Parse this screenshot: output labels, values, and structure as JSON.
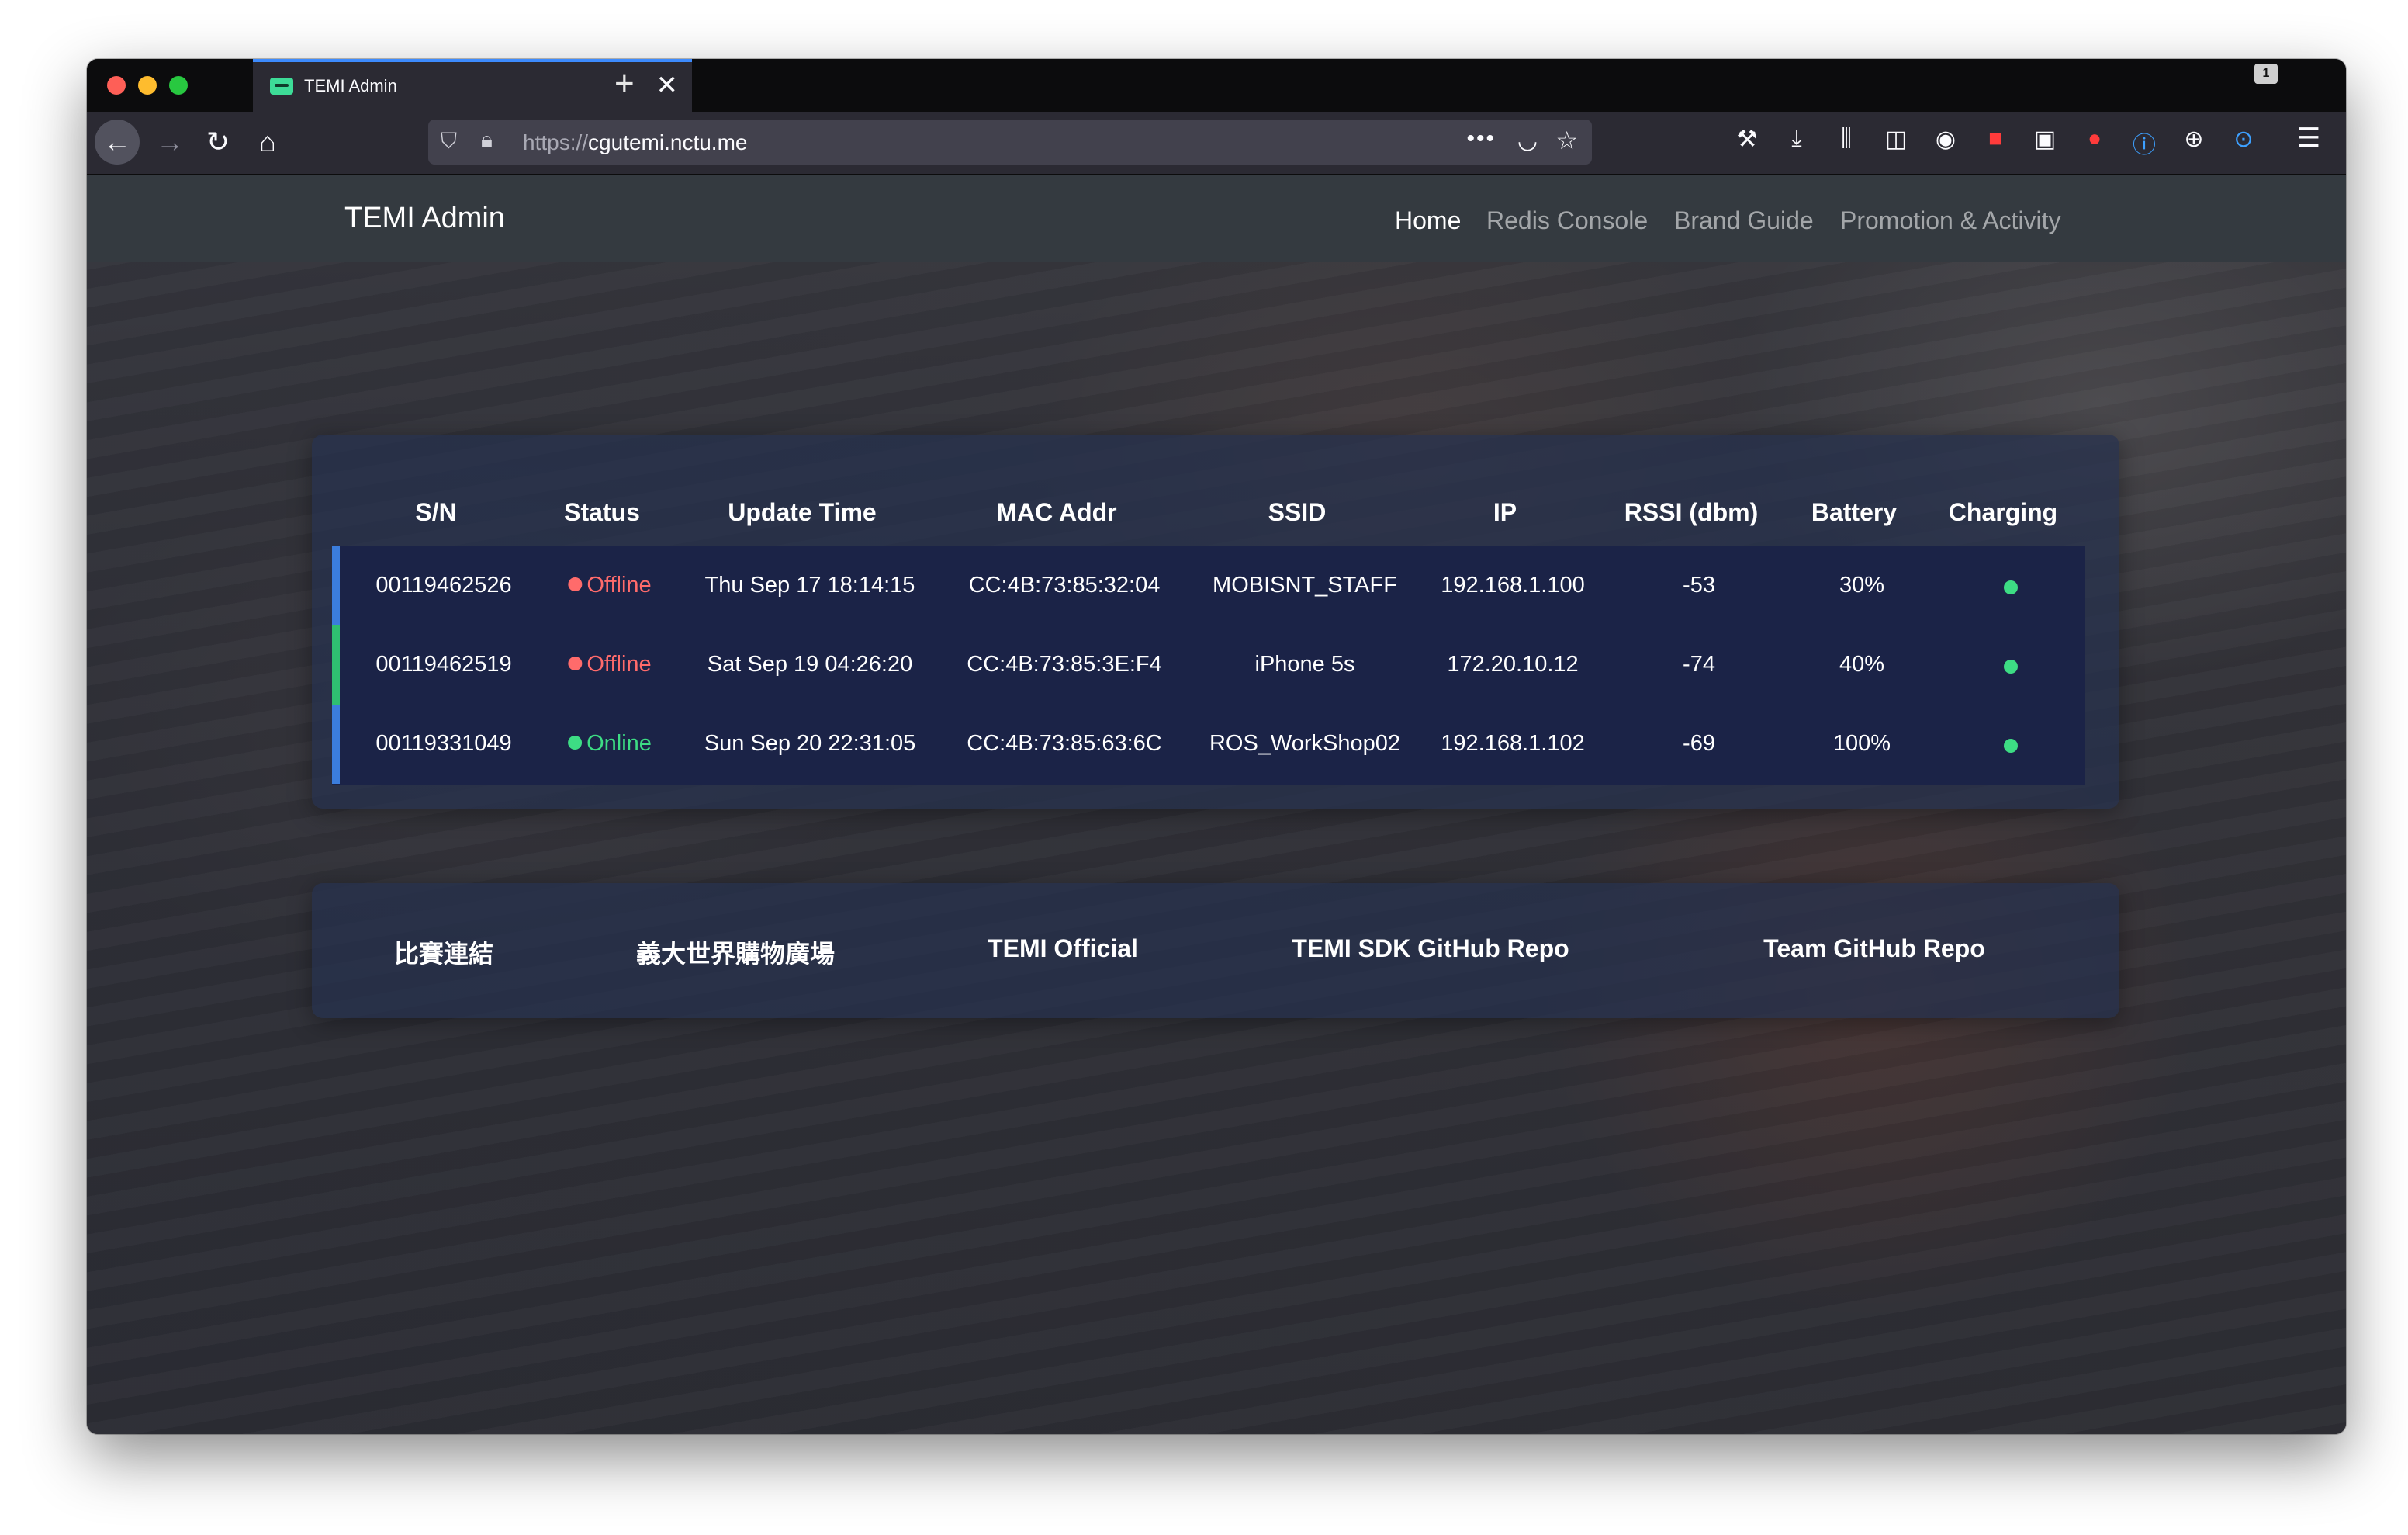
{
  "browser": {
    "tab_title": "TEMI Admin",
    "tab_close": "✕",
    "new_tab": "+",
    "url_scheme": "https://",
    "url_host": "cgutemi.nctu.me",
    "tab_count": "1",
    "icons": [
      "back-arrow-icon",
      "forward-arrow-icon",
      "reload-icon",
      "home-icon",
      "shield-icon",
      "lock-icon",
      "more-icon",
      "pocket-icon",
      "star-icon",
      "wrench-icon",
      "download-icon",
      "library-icon",
      "sidebar-icon",
      "account-icon",
      "extension-icon",
      "menu-icon"
    ]
  },
  "navbar": {
    "brand": "TEMI Admin",
    "links": [
      "Home",
      "Redis Console",
      "Brand Guide",
      "Promotion & Activity"
    ],
    "active": "Home"
  },
  "table": {
    "headers": [
      "S/N",
      "Status",
      "Update Time",
      "MAC Addr",
      "SSID",
      "IP",
      "RSSI (dbm)",
      "Battery",
      "Charging"
    ],
    "rows": [
      {
        "sn": "00119462526",
        "status": "Offline",
        "update_time": "Thu Sep 17 18:14:15",
        "mac": "CC:4B:73:85:32:04",
        "ssid": "MOBISNT_STAFF",
        "ip": "192.168.1.100",
        "rssi": "-53",
        "battery": "30%",
        "charging": true
      },
      {
        "sn": "00119462519",
        "status": "Offline",
        "update_time": "Sat Sep 19 04:26:20",
        "mac": "CC:4B:73:85:3E:F4",
        "ssid": "iPhone 5s",
        "ip": "172.20.10.12",
        "rssi": "-74",
        "battery": "40%",
        "charging": true
      },
      {
        "sn": "00119331049",
        "status": "Online",
        "update_time": "Sun Sep 20 22:31:05",
        "mac": "CC:4B:73:85:63:6C",
        "ssid": "ROS_WorkShop02",
        "ip": "192.168.1.102",
        "rssi": "-69",
        "battery": "100%",
        "charging": true
      }
    ]
  },
  "links": [
    "比賽連結",
    "義大世界購物廣場",
    "TEMI Official",
    "TEMI SDK GitHub Repo",
    "Team GitHub Repo"
  ],
  "colors": {
    "offline": "#ff6b6b",
    "online": "#3ddc84",
    "navbar": "#343a40",
    "table_body": "#1b2347"
  }
}
